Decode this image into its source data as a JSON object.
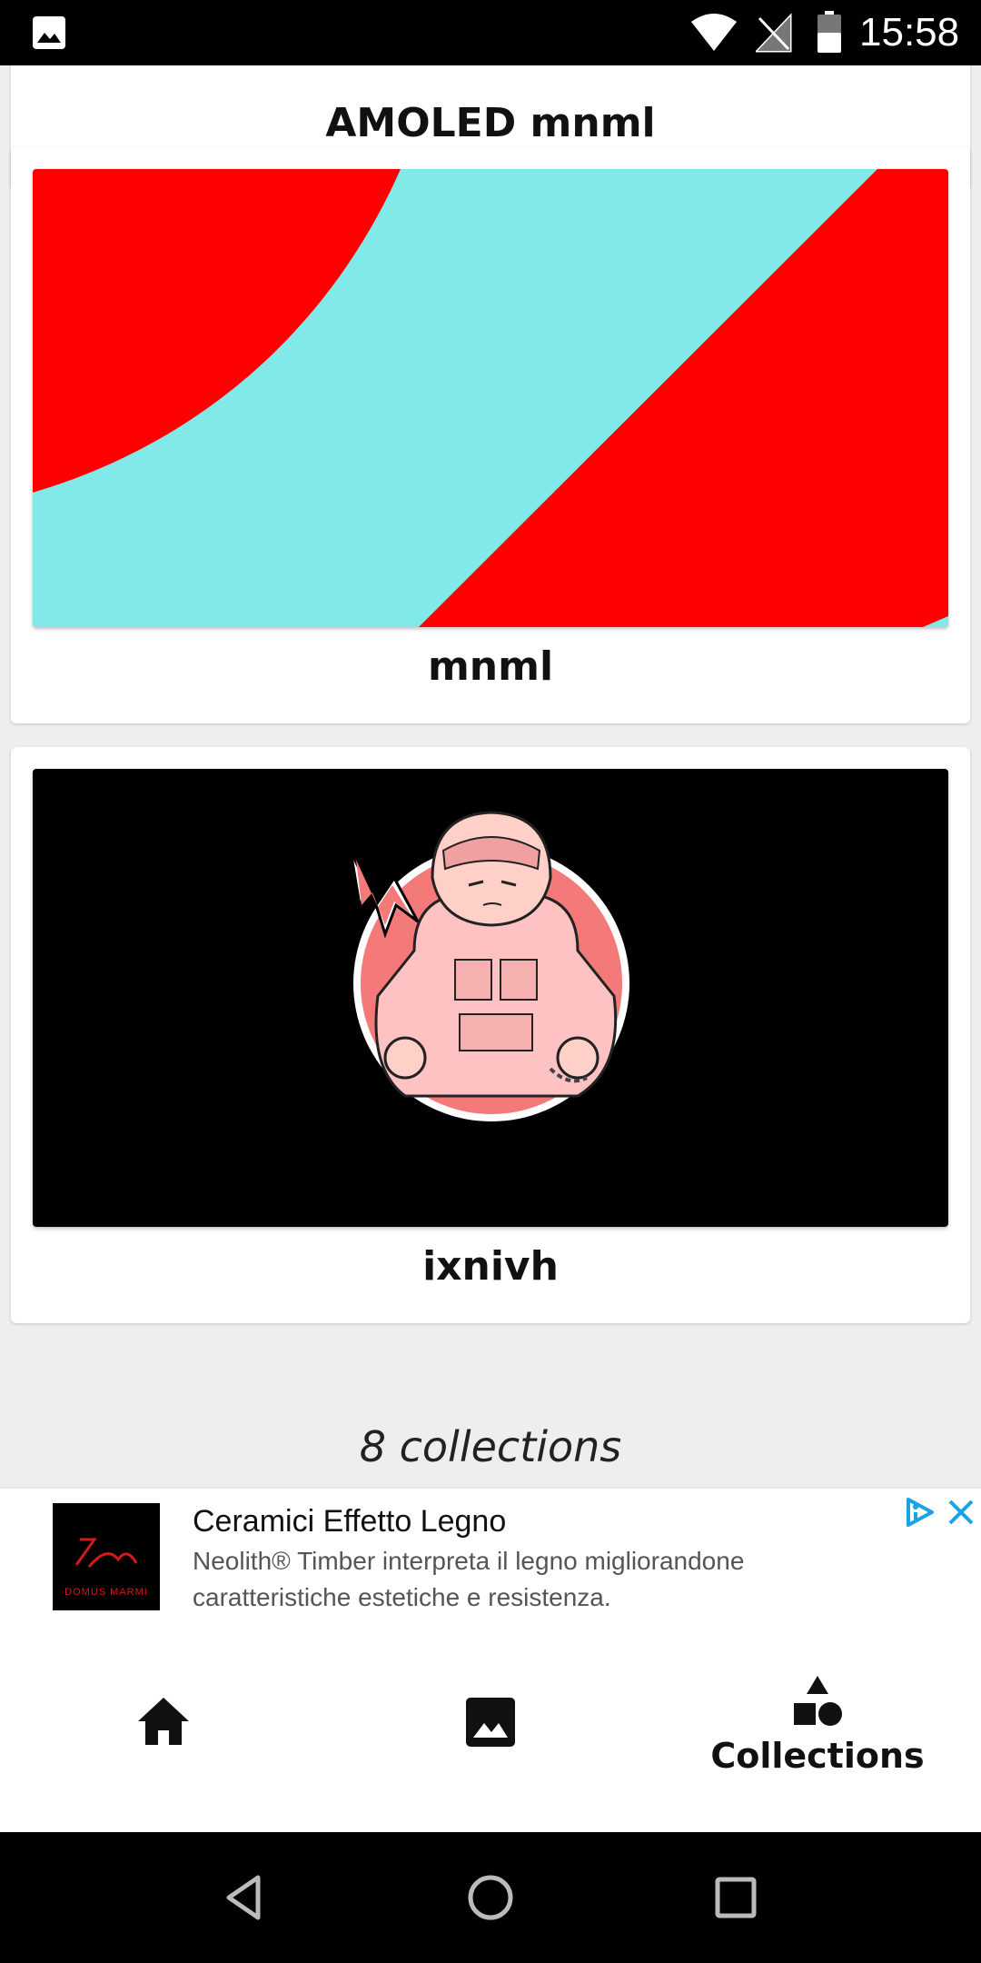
{
  "status_bar": {
    "time": "15:58",
    "icons": [
      "gallery-notification-icon",
      "wifi-icon",
      "no-signal-icon",
      "battery-icon"
    ]
  },
  "collections": [
    {
      "name": "AMOLED mnml",
      "thumbnail": "black"
    },
    {
      "name": "mnml",
      "thumbnail": "red-cyan-abstract"
    },
    {
      "name": "ixnivh",
      "thumbnail": "hooded-character-illustration"
    }
  ],
  "count_label": "8 collections",
  "ad": {
    "logo_text": "DOMUS MARMI",
    "title": "Ceramici Effetto Legno",
    "description": "Neolith® Timber interpreta il legno migliorandone caratteristiche estetiche e resistenza."
  },
  "bottom_nav": {
    "items": [
      {
        "icon": "home-icon",
        "label": ""
      },
      {
        "icon": "image-icon",
        "label": ""
      },
      {
        "icon": "shapes-icon",
        "label": "Collections",
        "active": true
      }
    ]
  },
  "colors": {
    "accent_red": "#ff0000",
    "accent_cyan": "#82e9e9",
    "ad_choices_blue": "#1aa1e6"
  }
}
